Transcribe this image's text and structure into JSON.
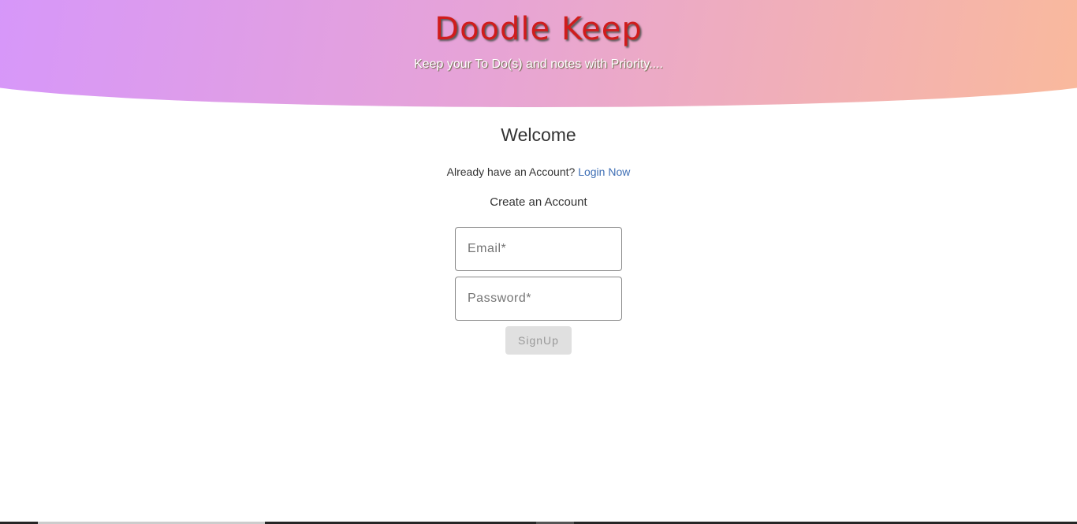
{
  "header": {
    "title": "Doodle Keep",
    "subtitle": "Keep your To Do(s) and notes with Priority...."
  },
  "main": {
    "welcome": "Welcome",
    "already_text": "Already have an Account?",
    "login_link": "Login Now",
    "create_label": "Create an Account",
    "email_placeholder": "Email*",
    "password_placeholder": "Password*",
    "signup_label": "SignUp"
  }
}
